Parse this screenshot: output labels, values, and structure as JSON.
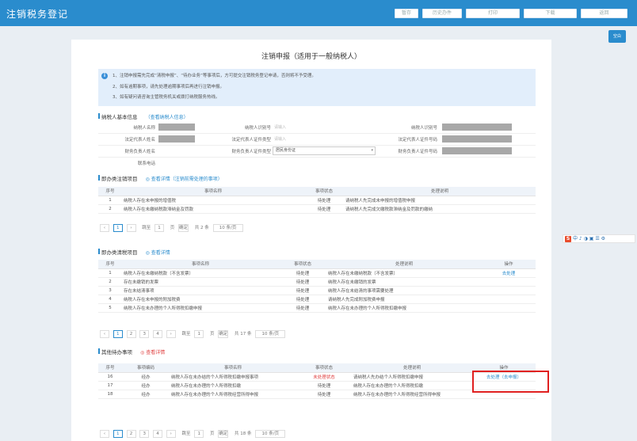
{
  "app": {
    "title": "注销税务登记"
  },
  "top_buttons": [
    "暂存",
    "历史办件",
    "打印",
    "下载",
    "返回"
  ],
  "side_tab": "空白",
  "main": {
    "title": "注销申报（适用于一般纳税人）"
  },
  "notice": {
    "lines": [
      "1、注销申报需先完成“清税申报”、“待办业务”等事项后，方可提交注销税务登记申请，否则将不予受理。",
      "2、如有逾期事项，请先处理逾期事项后再进行注销申报。",
      "3、如有疑问请咨询主管税务机关或拨打纳税服务热线。"
    ]
  },
  "basic": {
    "title": "纳税人基本信息",
    "link": "（查看纳税人信息）",
    "rows": [
      [
        {
          "label": "纳税人名称",
          "type": "gray"
        },
        {
          "label": "纳税人识别号",
          "type": "text",
          "value": "请输入"
        },
        {
          "label": "纳税人识别号",
          "type": "gray"
        }
      ],
      [
        {
          "label": "法定代表人姓名",
          "type": "gray"
        },
        {
          "label": "法定代表人证件类型",
          "type": "text",
          "value": "请输入"
        },
        {
          "label": "法定代表人证件号码",
          "type": "gray"
        }
      ],
      [
        {
          "label": "财务负责人姓名",
          "type": "blank"
        },
        {
          "label": "财务负责人证件类型",
          "type": "select",
          "value": "居民身份证"
        },
        {
          "label": "财务负责人证件号码",
          "type": "gray"
        }
      ],
      [
        {
          "label": "联系电话",
          "type": "blank"
        }
      ]
    ]
  },
  "section1": {
    "title": "即办类注销项目",
    "link": "◎ 查看详情（注销前需处理的事项）",
    "columns": [
      "序号",
      "事项名称",
      "事项状态",
      "处理说明"
    ],
    "rows": [
      [
        "1",
        "纳税人存在未申报的增值税",
        "待处理",
        "请纳税人先完成未申报的增值税申报"
      ],
      [
        "2",
        "纳税人存在未缴纳税款滞纳金及罚款",
        "待处理",
        "请纳税人先完成欠缴税款滞纳金及罚款的缴纳"
      ]
    ],
    "pager": {
      "pages": [
        "1"
      ],
      "goto_label": "跳至",
      "goto_value": "1",
      "page_unit": "页",
      "confirm": "确定",
      "total": "共 2 条",
      "size": "10 条/页"
    }
  },
  "section2": {
    "title": "即办类清税项目",
    "link": "◎ 查看详情",
    "columns": [
      "序号",
      "事项名称",
      "事项状态",
      "处理说明",
      "操作"
    ],
    "rows": [
      [
        "1",
        "纳税人存在未缴纳税款（不含发票）",
        "待处理",
        "纳税人存在未缴纳税款（不含发票）",
        "去处理"
      ],
      [
        "2",
        "存在未缴销的发票",
        "待处理",
        "纳税人存在未缴销的发票",
        ""
      ],
      [
        "3",
        "存在未结清事项",
        "待处理",
        "纳税人存在未结清的事项需要处理",
        ""
      ],
      [
        "4",
        "纳税人存在未申报的附加税费",
        "待处理",
        "请纳税人先完成附加税费申报",
        ""
      ],
      [
        "5",
        "纳税人存在未办理的个人所得税扣缴申报",
        "待处理",
        "纳税人存在未办理的个人所得税扣缴申报",
        ""
      ]
    ],
    "pager": {
      "pages": [
        "1",
        "2",
        "3",
        "4"
      ],
      "goto_label": "跳至",
      "goto_value": "1",
      "page_unit": "页",
      "confirm": "确定",
      "total": "共 17 条",
      "size": "10 条/页"
    }
  },
  "section3": {
    "title": "其他待办事项",
    "link": "◎ 查看详情",
    "columns": [
      "序号",
      "事项编码",
      "事项名称",
      "事项状态",
      "处理说明",
      "操作"
    ],
    "rows": [
      [
        "16",
        "经办",
        "纳税人存在未办结的个人所得税扣缴申报事项",
        "未处理状态",
        "请纳税人先办结个人所得税扣缴申报",
        "去处理（去申报）"
      ],
      [
        "17",
        "经办",
        "纳税人存在未办理的个人所得税扣缴",
        "待处理",
        "纳税人存在未办理的个人所得税扣缴",
        ""
      ],
      [
        "18",
        "经办",
        "纳税人存在未办理的个人所得税经营所得申报",
        "待处理",
        "纳税人存在未办理的个人所得税经营所得申报",
        ""
      ]
    ],
    "pager": {
      "pages": [
        "1",
        "2",
        "3",
        "4"
      ],
      "goto_label": "跳至",
      "goto_value": "1",
      "page_unit": "页",
      "confirm": "确定",
      "total": "共 18 条",
      "size": "10 条/页"
    }
  },
  "ime": {
    "label": "S",
    "items": "中 ♪ ◑ ▣ ☰ ⚙"
  }
}
